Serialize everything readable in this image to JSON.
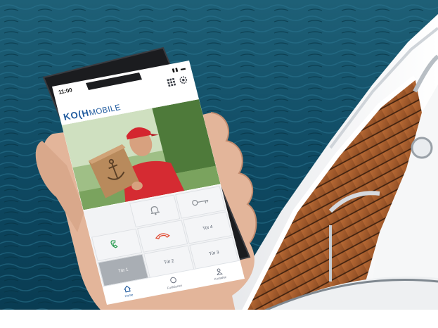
{
  "status_bar": {
    "time": "11:00"
  },
  "brand": {
    "name_prefix": "KO(H",
    "name_suffix": "MOBILE",
    "color": "#1f5a9e"
  },
  "header_icons": [
    "grid-icon",
    "gear-icon"
  ],
  "video_feed": {
    "subject": "delivery-person-with-parcel",
    "parcel_icon": "anchor-icon"
  },
  "action_tiles": {
    "row1": [
      "bell-icon",
      "key-icon"
    ],
    "row2": [
      "phone-accept-icon",
      "phone-hangup-icon"
    ],
    "doors": [
      "Tür 1",
      "Tür 2",
      "Tür 3",
      "Tür 4"
    ],
    "active_door": "Tür 1"
  },
  "tabbar": {
    "items": [
      {
        "label": "Home",
        "icon": "home-icon",
        "active": true
      },
      {
        "label": "Funktionen",
        "icon": "circle-icon",
        "active": false
      },
      {
        "label": "Kontakte",
        "icon": "person-icon",
        "active": false
      }
    ]
  },
  "colors": {
    "sea": "#0f4f6a",
    "deck": "#a0582c",
    "hull": "#f3f4f5",
    "accept": "#2f9e55",
    "hangup": "#e0482f"
  }
}
